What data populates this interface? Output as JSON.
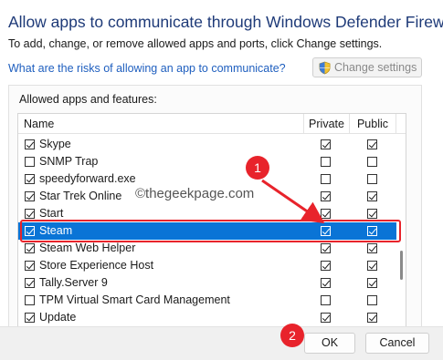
{
  "header": {
    "title": "Allow apps to communicate through Windows Defender Firewall",
    "subtitle": "To add, change, or remove allowed apps and ports, click Change settings.",
    "risk_link": "What are the risks of allowing an app to communicate?",
    "change_settings_label": "Change settings"
  },
  "allowed_apps": {
    "group_label": "Allowed apps and features:",
    "columns": {
      "name": "Name",
      "private": "Private",
      "public": "Public"
    },
    "rows": [
      {
        "name": "Skype",
        "enabled": true,
        "private": true,
        "public": true,
        "selected": false
      },
      {
        "name": "SNMP Trap",
        "enabled": false,
        "private": false,
        "public": false,
        "selected": false
      },
      {
        "name": "speedyforward.exe",
        "enabled": true,
        "private": false,
        "public": false,
        "selected": false
      },
      {
        "name": "Star Trek Online",
        "enabled": true,
        "private": true,
        "public": true,
        "selected": false
      },
      {
        "name": "Start",
        "enabled": true,
        "private": true,
        "public": true,
        "selected": false
      },
      {
        "name": "Steam",
        "enabled": true,
        "private": true,
        "public": true,
        "selected": true
      },
      {
        "name": "Steam Web Helper",
        "enabled": true,
        "private": true,
        "public": true,
        "selected": false
      },
      {
        "name": "Store Experience Host",
        "enabled": true,
        "private": true,
        "public": true,
        "selected": false
      },
      {
        "name": "Tally.Server 9",
        "enabled": true,
        "private": true,
        "public": true,
        "selected": false
      },
      {
        "name": "TPM Virtual Smart Card Management",
        "enabled": false,
        "private": false,
        "public": false,
        "selected": false
      },
      {
        "name": "Update",
        "enabled": true,
        "private": true,
        "public": true,
        "selected": false
      }
    ]
  },
  "annotations": {
    "badge_1": "1",
    "badge_2": "2",
    "watermark": "©thegeekpage.com",
    "highlight_color": "#e8232b"
  },
  "footer": {
    "ok_label": "OK",
    "cancel_label": "Cancel"
  },
  "colors": {
    "title": "#1e3a78",
    "link": "#1f5fbf",
    "selection": "#0a74d6"
  }
}
